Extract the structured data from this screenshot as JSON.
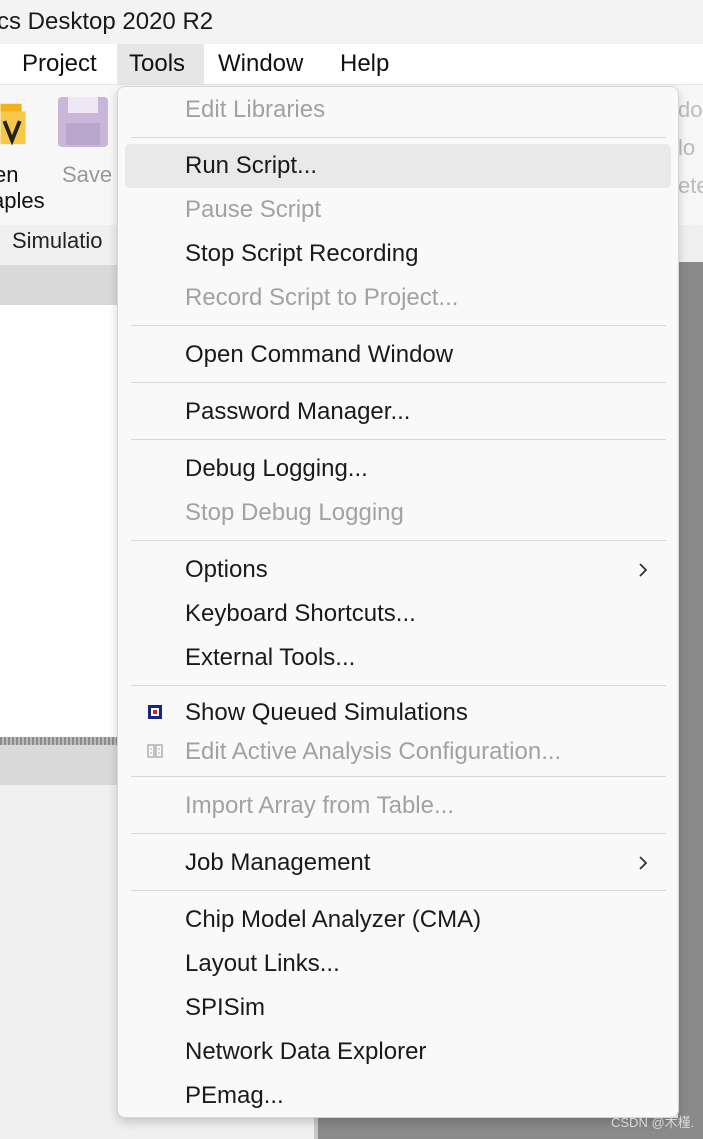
{
  "window": {
    "title": "cs Desktop 2020 R2"
  },
  "menubar": {
    "items": [
      "Project",
      "Tools",
      "Window",
      "Help"
    ],
    "open_item": "Tools"
  },
  "toolbar": {
    "open_label_line1": "en",
    "open_label_line2": "aples",
    "save_label": "Save",
    "right_fragments": [
      "do",
      "lo",
      "ete"
    ],
    "ribbon_tab": "Simulatio"
  },
  "tools_menu": {
    "items": [
      {
        "label": "Edit Libraries",
        "enabled": false
      },
      {
        "label": "Run Script...",
        "enabled": true,
        "highlighted": true
      },
      {
        "label": "Pause Script",
        "enabled": false
      },
      {
        "label": "Stop Script Recording",
        "enabled": true
      },
      {
        "label": "Record Script to Project...",
        "enabled": false
      },
      {
        "label": "Open Command Window",
        "enabled": true
      },
      {
        "label": "Password Manager...",
        "enabled": true
      },
      {
        "label": "Debug Logging...",
        "enabled": true
      },
      {
        "label": "Stop Debug Logging",
        "enabled": false
      },
      {
        "label": "Options",
        "enabled": true,
        "submenu": true
      },
      {
        "label": "Keyboard Shortcuts...",
        "enabled": true
      },
      {
        "label": "External Tools...",
        "enabled": true
      },
      {
        "label": "Show Queued Simulations",
        "enabled": true,
        "icon": "queue-icon"
      },
      {
        "label": "Edit Active Analysis Configuration...",
        "enabled": false,
        "icon": "analysis-config-icon"
      },
      {
        "label": "Import Array from Table...",
        "enabled": false
      },
      {
        "label": "Job Management",
        "enabled": true,
        "submenu": true
      },
      {
        "label": "Chip Model Analyzer (CMA)",
        "enabled": true
      },
      {
        "label": "Layout Links...",
        "enabled": true
      },
      {
        "label": "SPISim",
        "enabled": true
      },
      {
        "label": "Network Data Explorer",
        "enabled": true
      },
      {
        "label": "PEmag...",
        "enabled": true
      }
    ]
  },
  "watermark": "CSDN @木槿.",
  "colors": {
    "menu_bg": "#f9f9f9",
    "disabled_text": "#a2a2a2",
    "highlight": "#e9e9e9",
    "pane_dark": "#8a8a8a"
  }
}
